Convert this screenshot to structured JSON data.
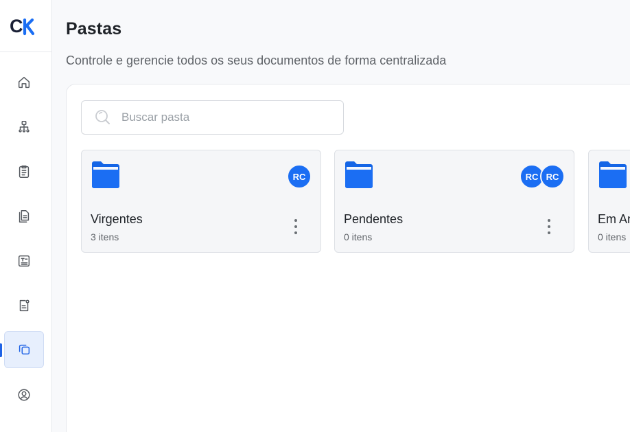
{
  "brand": {
    "logo_text": "CK",
    "accent": "#1b6ef3"
  },
  "sidebar": {
    "items": [
      {
        "icon": "home-icon",
        "active": false
      },
      {
        "icon": "sitemap-icon",
        "active": false
      },
      {
        "icon": "clipboard-list-icon",
        "active": false
      },
      {
        "icon": "documents-icon",
        "active": false
      },
      {
        "icon": "text-document-icon",
        "active": false
      },
      {
        "icon": "document-settings-icon",
        "active": false
      },
      {
        "icon": "folders-copy-icon",
        "active": true
      },
      {
        "icon": "user-circle-icon",
        "active": false
      }
    ]
  },
  "header": {
    "title": "Pastas",
    "subtitle": "Controle e gerencie todos os seus documentos de forma centralizada"
  },
  "search": {
    "placeholder": "Buscar pasta",
    "value": ""
  },
  "folders": [
    {
      "name": "Virgentes",
      "count": "3 itens",
      "avatars": [
        "RC"
      ]
    },
    {
      "name": "Pendentes",
      "count": "0 itens",
      "avatars": [
        "RC",
        "RC"
      ]
    },
    {
      "name": "Em An",
      "count": "0 itens",
      "avatars": []
    }
  ]
}
